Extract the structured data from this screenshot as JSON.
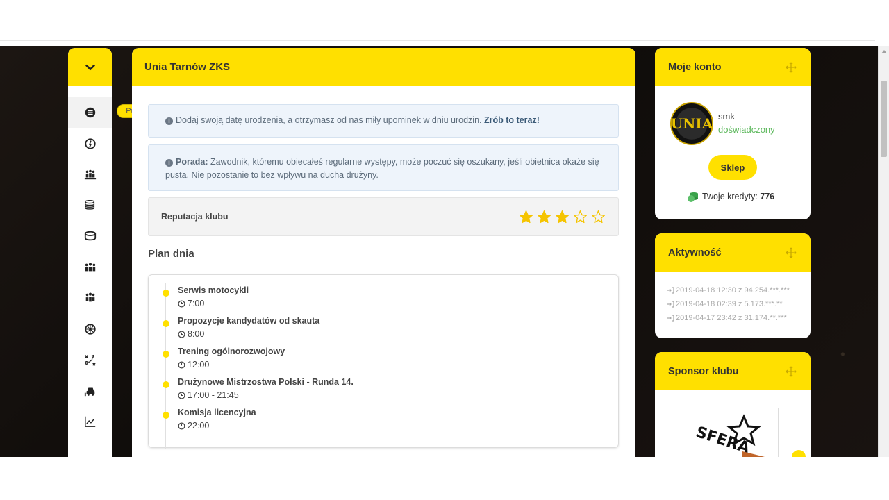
{
  "sidebar": {
    "toggle_icon": "chevron-down-icon",
    "tooltip": "Pulpit",
    "items": [
      {
        "name": "dashboard",
        "icon": "list-icon"
      },
      {
        "name": "speedometer",
        "icon": "speed-icon"
      },
      {
        "name": "team",
        "icon": "team-icon"
      },
      {
        "name": "finances",
        "icon": "coins-icon"
      },
      {
        "name": "stadium",
        "icon": "stadium-icon"
      },
      {
        "name": "riders",
        "icon": "people-icon"
      },
      {
        "name": "staff",
        "icon": "group-icon"
      },
      {
        "name": "wheel",
        "icon": "wheel-icon"
      },
      {
        "name": "tactics",
        "icon": "tactics-icon"
      },
      {
        "name": "garage",
        "icon": "garage-icon"
      },
      {
        "name": "stats",
        "icon": "chart-icon"
      }
    ]
  },
  "main": {
    "title": "Unia Tarnów ZKS",
    "alert1": {
      "text": "Dodaj swoją datę urodzenia, a otrzymasz od nas miły upominek w dniu urodzin.",
      "link": "Zrób to teraz!"
    },
    "alert2": {
      "label": "Porada:",
      "text": "Zawodnik, któremu obiecałeś regularne występy, może poczuć się oszukany, jeśli obietnica okaże się pusta. Nie pozostanie to bez wpływu na ducha drużyny."
    },
    "reputation": {
      "label": "Reputacja klubu",
      "stars_filled": 3,
      "stars_total": 5
    },
    "plan": {
      "title": "Plan dnia",
      "items": [
        {
          "title": "Serwis motocykli",
          "time": "7:00"
        },
        {
          "title": "Propozycje kandydatów od skauta",
          "time": "8:00"
        },
        {
          "title": "Trening ogólnorozwojowy",
          "time": "12:00"
        },
        {
          "title": "Drużynowe Mistrzostwa Polski - Runda 14.",
          "time": "17:00 - 21:45"
        },
        {
          "title": "Komisja licencyjna",
          "time": "22:00"
        }
      ]
    }
  },
  "account": {
    "title": "Moje konto",
    "avatar_text": "UNIA",
    "username": "smk",
    "rank": "doświadczony",
    "shop_button": "Sklep",
    "credits_label": "Twoje kredyty:",
    "credits_value": "776"
  },
  "activity": {
    "title": "Aktywność",
    "rows": [
      "2019-04-18 12:30 z 94.254.***.***",
      "2019-04-18 02:39 z 5.173.***.**",
      "2019-04-17 23:42 z 31.174.**.***"
    ]
  },
  "sponsor": {
    "title": "Sponsor klubu",
    "logo_text": "SFERA"
  },
  "colors": {
    "accent": "#ffe000",
    "rank": "#5cb85c",
    "alert_bg": "#eef4fb"
  }
}
